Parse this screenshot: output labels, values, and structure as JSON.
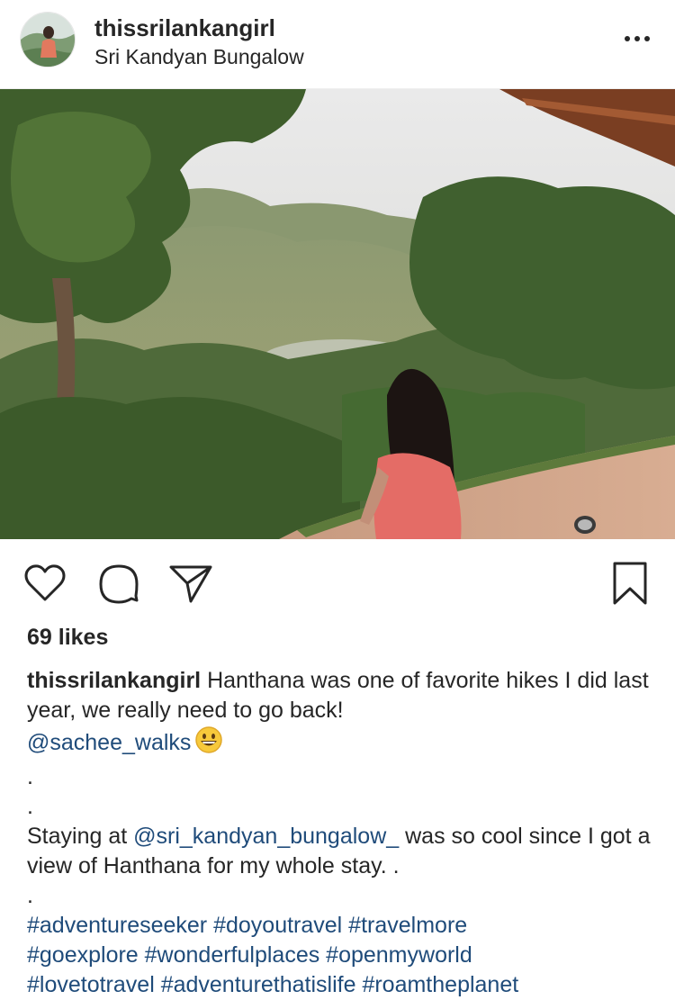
{
  "post": {
    "username": "thissrilankangirl",
    "location": "Sri Kandyan Bungalow"
  },
  "icons": {
    "more": "more-horizontal-icon",
    "like": "heart-outline-icon",
    "comment": "comment-bubble-icon",
    "share": "paper-plane-icon",
    "save": "bookmark-outline-icon",
    "emoji": "grinning-face-emoji"
  },
  "engagement": {
    "likes_text": "69 likes"
  },
  "caption": {
    "username": "thissrilankangirl",
    "text_line1": " Hanthana was one of favorite hikes I did last year, we really need to go back!",
    "mention1": "@sachee_walks",
    "dot1": ".",
    "dot2": ".",
    "text_before_mention2": "Staying at ",
    "mention2": "@sri_kandyan_bungalow_",
    "text_after_mention2": " was so cool since I got a view of Hanthana for my whole stay. .",
    "dot3": ".",
    "hashtags": [
      "#adventureseeker #doyoutravel #travelmore",
      "#goexplore #wonderfulplaces #openmyworld",
      "#lovetotravel #adventurethatislife #roamtheplanet"
    ]
  },
  "colors": {
    "text": "#262626",
    "link": "#1f4b7a",
    "background": "#ffffff"
  }
}
